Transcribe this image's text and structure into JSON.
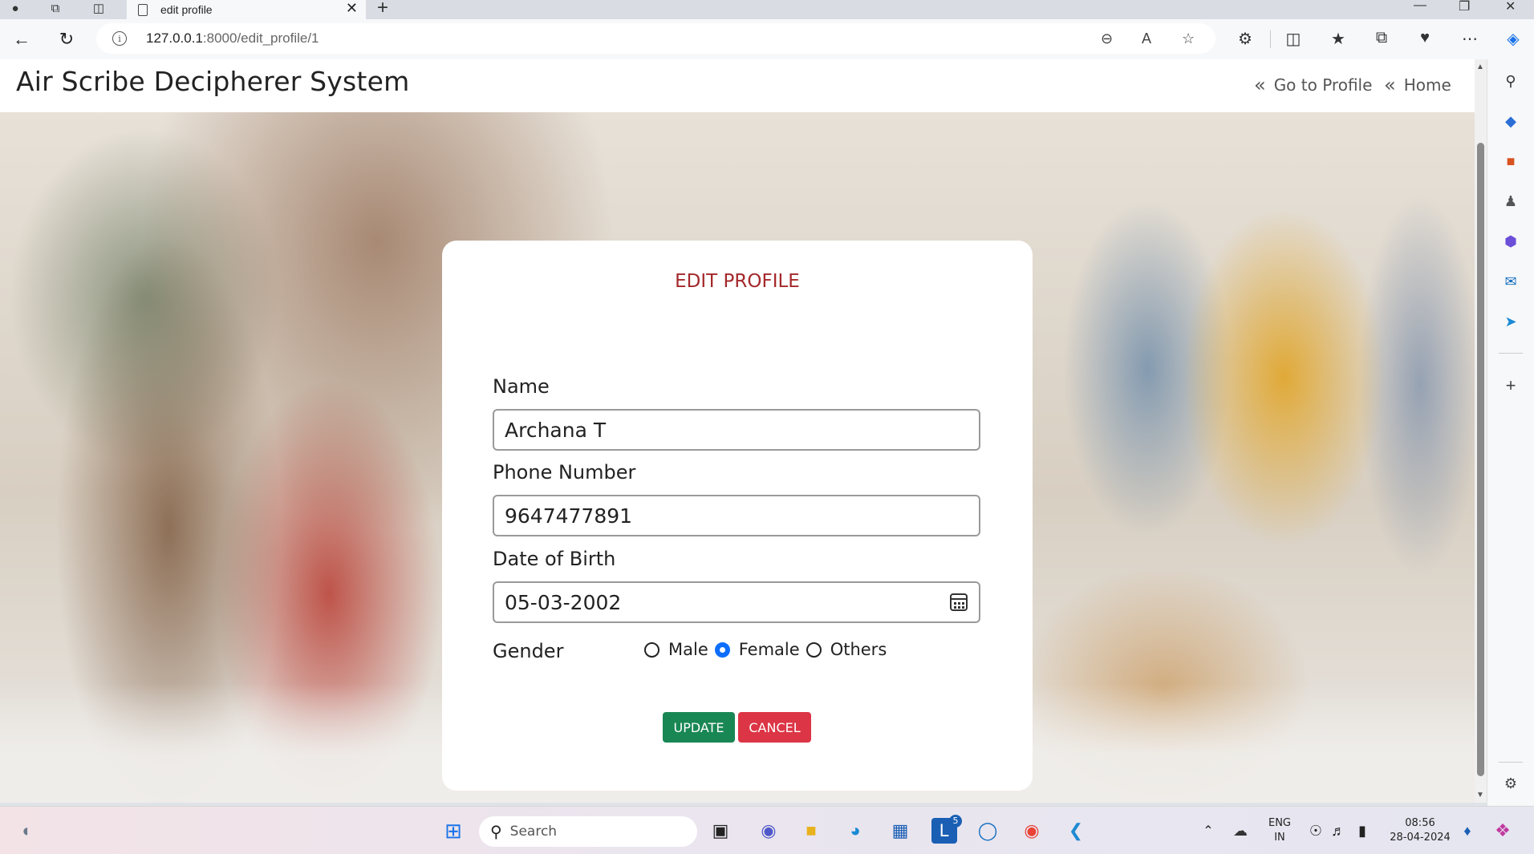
{
  "browser": {
    "tab_title": "edit profile",
    "url_host": "127.0.0.1",
    "url_path": ":8000/edit_profile/1"
  },
  "site": {
    "brand": "Air Scribe Decipherer System",
    "nav": {
      "go_to_profile": "Go to Profile",
      "home": "Home"
    }
  },
  "form": {
    "title": "EDIT PROFILE",
    "name_label": "Name",
    "name_value": "Archana T",
    "phone_label": "Phone Number",
    "phone_value": "9647477891",
    "dob_label": "Date of Birth",
    "dob_value": "05-03-2002",
    "gender_label": "Gender",
    "gender_options": [
      "Male",
      "Female",
      "Others"
    ],
    "gender_selected": "Female",
    "update_label": "UPDATE",
    "cancel_label": "CANCEL"
  },
  "taskbar": {
    "search_placeholder": "Search",
    "lang_line1": "ENG",
    "lang_line2": "IN",
    "time": "08:56",
    "date": "28-04-2024",
    "badge_count": "5"
  },
  "colors": {
    "title_red": "#a4282b",
    "update_green": "#198754",
    "cancel_red": "#dc3545",
    "radio_blue": "#0d6efd"
  }
}
